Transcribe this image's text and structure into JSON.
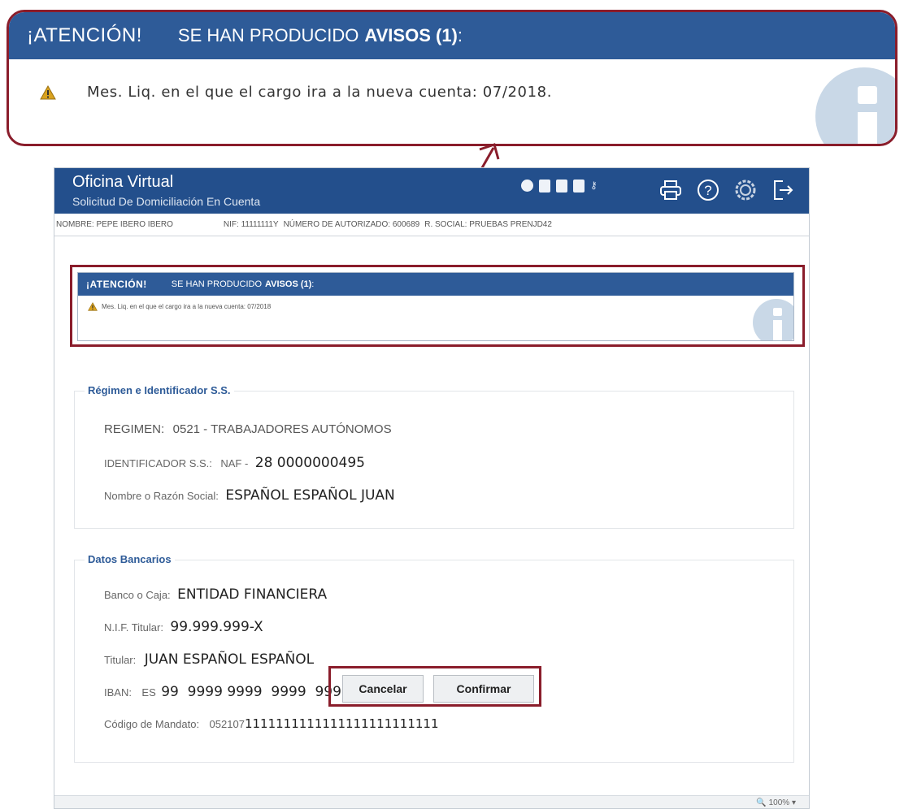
{
  "callout": {
    "attention": "¡ATENCIÓN!",
    "produced": "SE HAN PRODUCIDO",
    "notices": "AVISOS (1)",
    "colon": ":",
    "message": "Mes. Liq. en el que el cargo ira a la nueva cuenta: 07/2018.",
    "warning_icon": "warning-triangle-icon",
    "info_icon": "info-icon"
  },
  "window": {
    "app_title": "Oficina Virtual",
    "page_subtitle": "Solicitud De Domiciliación En Cuenta",
    "toolbar_icons": [
      "globe-icon",
      "document-search-icon",
      "bookmark-icon",
      "document-edit-icon",
      "key-icon"
    ],
    "action_icons": [
      "print-icon",
      "help-icon",
      "settings-icon",
      "logout-icon"
    ]
  },
  "userbar": {
    "name": "NOMBRE: PEPE IBERO IBERO",
    "nif": "NIF: 11111111Y",
    "auth": "NÚMERO DE AUTORIZADO: 600689",
    "social": "R. SOCIAL: PRUEBAS PRENJD42"
  },
  "warning_panel": {
    "attention": "¡ATENCIÓN!",
    "produced": "SE HAN PRODUCIDO",
    "notices": "AVISOS (1)",
    "colon": ":",
    "message": "Mes. Liq. en el que el cargo ira a la nueva cuenta: 07/2018"
  },
  "regimen": {
    "legend": "Régimen e Identificador S.S.",
    "regimen_label": "REGIMEN:",
    "regimen_value": "0521 - TRABAJADORES AUTÓNOMOS",
    "ident_label": "IDENTIFICADOR S.S.:",
    "ident_prefix": "NAF -",
    "ident_value": "28 0000000495",
    "name_label": "Nombre o Razón Social:",
    "name_value": "ESPAÑOL ESPAÑOL JUAN"
  },
  "banco": {
    "legend": "Datos Bancarios",
    "bank_label": "Banco o Caja:",
    "bank_value": "ENTIDAD FINANCIERA",
    "nif_label": "N.I.F. Titular:",
    "nif_value": "99.999.999-X",
    "holder_label": "Titular:",
    "holder_value": "JUAN ESPAÑOL ESPAÑOL",
    "iban_label": "IBAN:",
    "iban_prefix": "ES",
    "iban_value": "99  9999 9999  9999  9999  9999",
    "mandate_label": "Código de Mandato:",
    "mandate_prefix": "052107",
    "mandate_value": "1111111111111111111111111"
  },
  "buttons": {
    "cancel": "Cancelar",
    "confirm": "Confirmar"
  },
  "status": {
    "zoom": "100%"
  },
  "colors": {
    "header_blue": "#234f8c",
    "notice_blue": "#2e5b98",
    "highlight_red": "#8a1d2b",
    "info_circle": "#c9d8e7"
  }
}
